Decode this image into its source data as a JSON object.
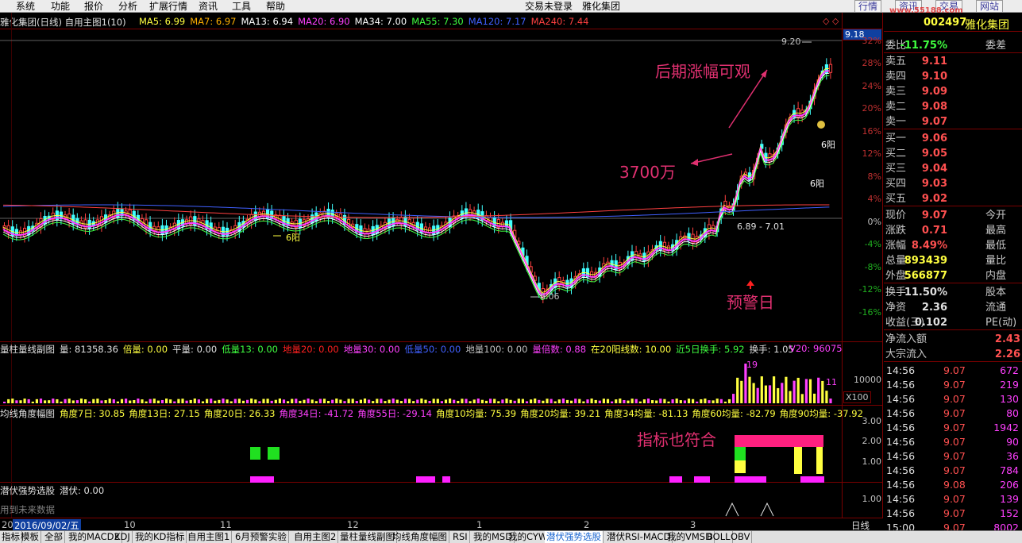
{
  "menu": [
    "系统",
    "功能",
    "报价",
    "分析",
    "扩展行情",
    "资讯",
    "工具",
    "帮助"
  ],
  "login_status": "交易未登录",
  "stock_name_top": "雅化集团",
  "nav_buttons": [
    "行情",
    "资讯",
    "交易",
    "网站"
  ],
  "watermark": "www.55188.com",
  "chart_title": "雅化集团(日线) 自用主图1(10)",
  "ma_labels": [
    {
      "text": "MA5: 6.99",
      "color": "#ffff40"
    },
    {
      "text": "MA7: 6.97",
      "color": "#ffb000"
    },
    {
      "text": "MA13: 6.94",
      "color": "#ffffff"
    },
    {
      "text": "MA20: 6.90",
      "color": "#ff40ff"
    },
    {
      "text": "MA34: 7.00",
      "color": "#ffffff"
    },
    {
      "text": "MA55: 7.30",
      "color": "#40ff40"
    },
    {
      "text": "MA120: 7.17",
      "color": "#4060ff"
    },
    {
      "text": "MA240: 7.44",
      "color": "#ff4040"
    }
  ],
  "price_scale_top": "9.18",
  "pct_axis": [
    "32%",
    "28%",
    "24%",
    "20%",
    "16%",
    "12%",
    "8%",
    "4%",
    "0%",
    "-4%",
    "-8%",
    "-12%",
    "-16%"
  ],
  "price_labels": {
    "high": "9.20",
    "low": "6.06",
    "mid": "6.89 - 7.01",
    "sixyang_left": "6阳",
    "sixyang_r1": "6阳",
    "sixyang_r2": "6阳"
  },
  "annotations": {
    "later": "后期涨幅可观",
    "amount": "3700万",
    "warning": "预警日",
    "indicator": "指标也符合"
  },
  "volume_panel": {
    "title": "量柱量线副图",
    "items": [
      {
        "text": "量: 81358.36",
        "color": "#e0e0e0"
      },
      {
        "text": "倍量: 0.00",
        "color": "#ffff40"
      },
      {
        "text": "平量: 0.00",
        "color": "#e0e0e0"
      },
      {
        "text": "低量13: 0.00",
        "color": "#40ff40"
      },
      {
        "text": "地量20: 0.00",
        "color": "#ff2020"
      },
      {
        "text": "地量30: 0.00",
        "color": "#ff40ff"
      },
      {
        "text": "低量50: 0.00",
        "color": "#4060ff"
      },
      {
        "text": "地量100: 0.00",
        "color": "#c0c0c0"
      },
      {
        "text": "量倍数: 0.88",
        "color": "#ff40ff"
      },
      {
        "text": "在20阳线数: 10.00",
        "color": "#ffff40"
      },
      {
        "text": "近5日换手: 5.92",
        "color": "#40ff40"
      },
      {
        "text": "换手: 1.05",
        "color": "#e0e0e0"
      },
      {
        "text": "V20: 96075",
        "color": "#ff40ff"
      }
    ],
    "scale": "10000",
    "unit": "X100",
    "peak": "19",
    "peak2": "11"
  },
  "angle_panel": {
    "title": "均线角度幅图",
    "items": [
      {
        "text": "角度7日: 30.85",
        "color": "#ffff40"
      },
      {
        "text": "角度13日: 27.15",
        "color": "#ffff40"
      },
      {
        "text": "角度20日: 26.33",
        "color": "#ffff40"
      },
      {
        "text": "角度34日: -41.72",
        "color": "#ff40ff"
      },
      {
        "text": "角度55日: -29.14",
        "color": "#ff40ff"
      },
      {
        "text": "角度10均量: 75.39",
        "color": "#ffff40"
      },
      {
        "text": "角度20均量: 39.21",
        "color": "#ffff40"
      },
      {
        "text": "角度34均量: -81.13",
        "color": "#ffff40"
      },
      {
        "text": "角度60均量: -82.79",
        "color": "#ffff40"
      },
      {
        "text": "角度90均量: -37.92",
        "color": "#ffff40"
      }
    ],
    "scale": [
      "3.00",
      "2.00",
      "1.00"
    ]
  },
  "lurk_panel": {
    "title": "潜伏强势选股",
    "value": "潜伏: 0.00",
    "note": "用到未来数据",
    "scale": "1.00"
  },
  "date_axis": {
    "start": "20",
    "cursor": "2016/09/02/五",
    "months": [
      "10",
      "11",
      "12",
      "1",
      "2",
      "3"
    ],
    "period": "日线"
  },
  "quote": {
    "code": "002497",
    "name": "雅化集团",
    "weibi_label": "委比",
    "weibi": "-11.75%",
    "weicha_label": "委差",
    "asks": [
      {
        "l": "卖五",
        "v": "9.11"
      },
      {
        "l": "卖四",
        "v": "9.10"
      },
      {
        "l": "卖三",
        "v": "9.09"
      },
      {
        "l": "卖二",
        "v": "9.08"
      },
      {
        "l": "卖一",
        "v": "9.07"
      }
    ],
    "bids": [
      {
        "l": "买一",
        "v": "9.06"
      },
      {
        "l": "买二",
        "v": "9.05"
      },
      {
        "l": "买三",
        "v": "9.04"
      },
      {
        "l": "买四",
        "v": "9.03"
      },
      {
        "l": "买五",
        "v": "9.02"
      }
    ],
    "stats": [
      {
        "l": "现价",
        "v": "9.07",
        "r": "今开"
      },
      {
        "l": "涨跌",
        "v": "0.71",
        "r": "最高"
      },
      {
        "l": "涨幅",
        "v": "8.49%",
        "r": "最低"
      },
      {
        "l": "总量",
        "v": "893439",
        "r": "量比",
        "vc": "#ffff40"
      },
      {
        "l": "外盘",
        "v": "566877",
        "r": "内盘",
        "vc": "#ffff40"
      },
      {
        "l": "换手",
        "v": "11.50%",
        "r": "股本",
        "vc": "#e0e0e0"
      },
      {
        "l": "净资",
        "v": "2.36",
        "r": "流通",
        "vc": "#e0e0e0"
      },
      {
        "l": "收益(三)",
        "v": "0.102",
        "r": "PE(动)",
        "vc": "#e0e0e0"
      }
    ],
    "flows": [
      {
        "l": "净流入额",
        "v": "2.43"
      },
      {
        "l": "大宗流入",
        "v": "2.26"
      }
    ],
    "ticks": [
      {
        "t": "14:56",
        "p": "9.07",
        "q": "672"
      },
      {
        "t": "14:56",
        "p": "9.07",
        "q": "219"
      },
      {
        "t": "14:56",
        "p": "9.07",
        "q": "130"
      },
      {
        "t": "14:56",
        "p": "9.07",
        "q": "80"
      },
      {
        "t": "14:56",
        "p": "9.07",
        "q": "1942"
      },
      {
        "t": "14:56",
        "p": "9.07",
        "q": "90"
      },
      {
        "t": "14:56",
        "p": "9.07",
        "q": "36"
      },
      {
        "t": "14:56",
        "p": "9.07",
        "q": "784"
      },
      {
        "t": "14:56",
        "p": "9.08",
        "q": "206"
      },
      {
        "t": "14:56",
        "p": "9.07",
        "q": "139"
      },
      {
        "t": "14:56",
        "p": "9.07",
        "q": "152"
      },
      {
        "t": "15:00",
        "p": "9.07",
        "q": "8002"
      }
    ]
  },
  "tabs": [
    "指标",
    "模板",
    "全部",
    "我的MACD2",
    "KDJ",
    "我的KD指标",
    "自用主图1",
    "6月预警实验",
    "自用主图2",
    "量柱量线副图",
    "均线角度幅图",
    "RSI",
    "我的MSD",
    "我的CYW",
    "潜伏强势选股",
    "潜伏RSI-MACD",
    "我的VMSD",
    "BOLL",
    "OBV"
  ],
  "selected_tab": "潜伏强势选股",
  "colors": {
    "up": "#ff4040",
    "down": "#40ffff",
    "grid": "#7a0000",
    "accent": "#e0e040"
  }
}
